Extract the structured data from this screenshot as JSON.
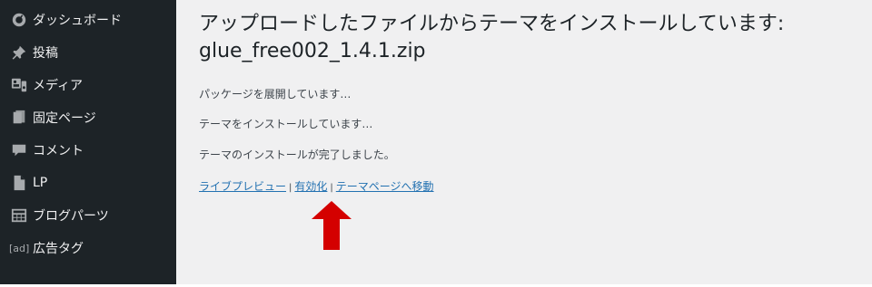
{
  "sidebar": {
    "items": [
      {
        "label": "ダッシュボード",
        "icon": "dashboard-icon"
      },
      {
        "label": "投稿",
        "icon": "pin-icon"
      },
      {
        "label": "メディア",
        "icon": "media-icon"
      },
      {
        "label": "固定ページ",
        "icon": "page-icon"
      },
      {
        "label": "コメント",
        "icon": "comment-icon"
      },
      {
        "label": "LP",
        "icon": "document-icon"
      },
      {
        "label": "ブログパーツ",
        "icon": "grid-icon"
      },
      {
        "label": "広告タグ",
        "icon": "ad-icon",
        "badge": "[ad]"
      }
    ]
  },
  "main": {
    "title": "アップロードしたファイルからテーマをインストールしています: glue_free002_1.4.1.zip",
    "messages": [
      "パッケージを展開しています…",
      "テーマをインストールしています…",
      "テーマのインストールが完了しました。"
    ],
    "links": {
      "preview": "ライブプレビュー",
      "activate": "有効化",
      "theme_page": "テーマページへ移動",
      "separator": "|"
    }
  },
  "annotation": {
    "arrow_color": "#d40000"
  }
}
